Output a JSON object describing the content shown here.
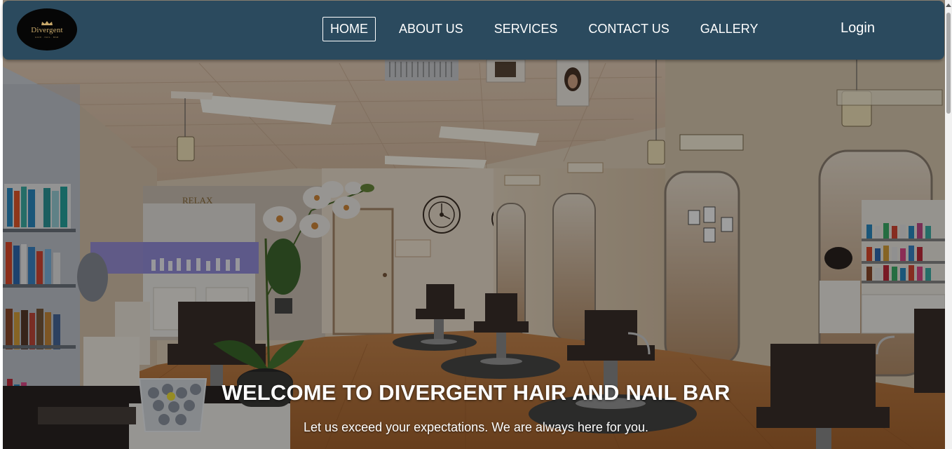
{
  "brand": {
    "logo_text": "Divergent",
    "logo_tagline": "HAIR · NAIL · BAR",
    "logo_icon": "crown-icon",
    "accent_gold": "#c9a96b"
  },
  "navbar": {
    "background": "#2b4a5e",
    "items": [
      {
        "label": "HOME",
        "active": true
      },
      {
        "label": "ABOUT US",
        "active": false
      },
      {
        "label": "SERVICES",
        "active": false
      },
      {
        "label": "CONTACT US",
        "active": false
      },
      {
        "label": "GALLERY",
        "active": false
      }
    ],
    "login_label": "Login"
  },
  "hero": {
    "wall_sign": "RELAX",
    "title": "WELCOME TO DIVERGENT HAIR AND NAIL BAR",
    "subtitle": "Let us exceed your expectations. We are always here for you."
  },
  "scrollbar": {
    "up_icon": "scroll-up-arrow-icon"
  }
}
